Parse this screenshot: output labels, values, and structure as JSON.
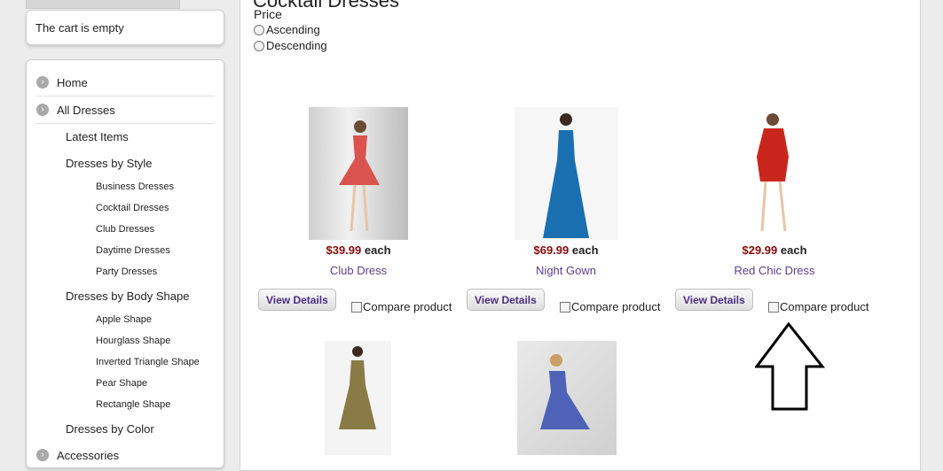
{
  "cart": {
    "text": "The cart is empty"
  },
  "nav": {
    "home": "Home",
    "all_dresses": "All Dresses",
    "latest": "Latest Items",
    "by_style": "Dresses by Style",
    "style_items": [
      "Business Dresses",
      "Cocktail Dresses",
      "Club Dresses",
      "Daytime Dresses",
      "Party Dresses"
    ],
    "by_body": "Dresses by Body Shape",
    "body_items": [
      "Apple Shape",
      "Hourglass Shape",
      "Inverted Triangle Shape",
      "Pear Shape",
      "Rectangle Shape"
    ],
    "by_color": "Dresses by Color",
    "accessories": "Accessories"
  },
  "main": {
    "title": "Cocktail Dresses",
    "sort_label": "Price",
    "sort_options": [
      "Ascending",
      "Descending"
    ]
  },
  "products": [
    {
      "price": "$39.99",
      "each": "each",
      "name": "Club Dress",
      "view": "View Details",
      "compare": "Compare product",
      "color": "#d9534f"
    },
    {
      "price": "$69.99",
      "each": "each",
      "name": "Night Gown",
      "view": "View Details",
      "compare": "Compare product",
      "color": "#1a6fb0"
    },
    {
      "price": "$29.99",
      "each": "each",
      "name": "Red Chic Dress",
      "view": "View Details",
      "compare": "Compare product",
      "color": "#c8261d"
    },
    {
      "color": "#8a7a45"
    },
    {
      "color": "#4e63b8"
    }
  ],
  "annotation": {
    "icon": "up-arrow-icon"
  }
}
